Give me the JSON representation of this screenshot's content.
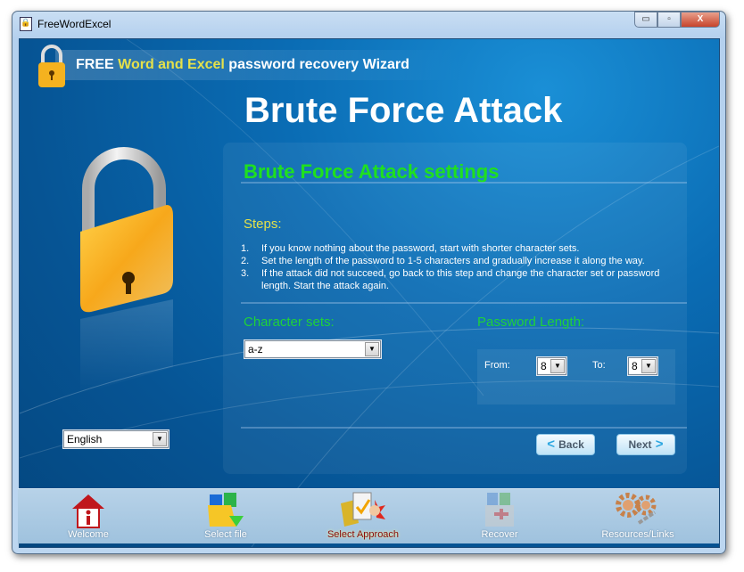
{
  "window": {
    "title": "FreeWordExcel",
    "minimize": "▭",
    "maximize": "▫",
    "close": "X"
  },
  "banner": {
    "prefix": "FREE ",
    "highlight": "Word and Excel",
    "suffix": " password recovery Wizard"
  },
  "page_title": "Brute Force Attack",
  "settings_title": "Brute Force Attack settings",
  "steps": {
    "title": "Steps:",
    "items": [
      {
        "n": "1.",
        "text": "If you know nothing about the password, start with shorter character sets."
      },
      {
        "n": "2.",
        "text": "Set the length of the password to 1-5 characters and gradually increase it along the way."
      },
      {
        "n": "3.",
        "text": "If the attack did not succeed, go back to this step and change the character set or password length. Start the attack again."
      }
    ]
  },
  "character_sets": {
    "label": "Character sets:",
    "value": "a-z"
  },
  "password_length": {
    "label": "Password Length:",
    "from_label": "From:",
    "from_value": "8",
    "to_label": "To:",
    "to_value": "8"
  },
  "language": {
    "value": "English"
  },
  "buttons": {
    "back": "Back",
    "next": "Next"
  },
  "nav": [
    {
      "label": "Welcome",
      "icon": "home-icon"
    },
    {
      "label": "Select file",
      "icon": "select-file-icon"
    },
    {
      "label": "Select Approach",
      "icon": "select-approach-icon",
      "active": true
    },
    {
      "label": "Recover",
      "icon": "recover-icon"
    },
    {
      "label": "Resources/Links",
      "icon": "gears-icon"
    }
  ],
  "colors": {
    "accent_green": "#1fe01f",
    "accent_yellow": "#e5e14a",
    "background_blue": "#0a6cb4",
    "active_nav": "#8a0a0a"
  }
}
